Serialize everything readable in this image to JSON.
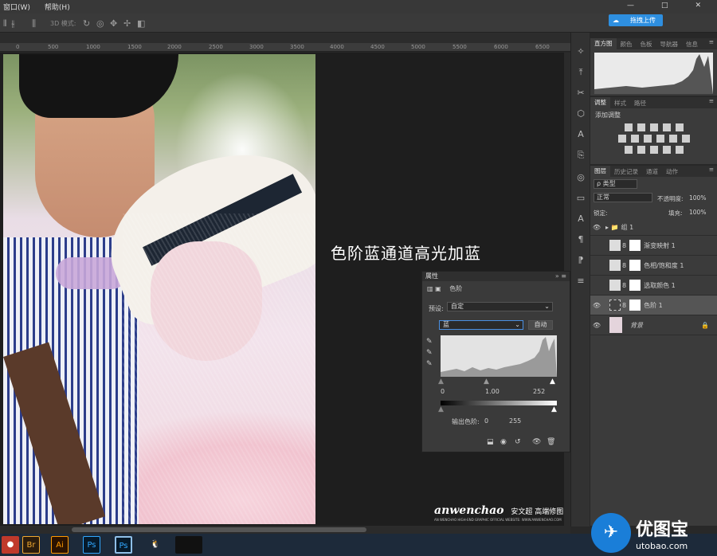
{
  "menubar": {
    "items": [
      "窗口(W)",
      "帮助(H)"
    ]
  },
  "window_controls": [
    "—",
    "□",
    "✕"
  ],
  "options_bar": {
    "mode_label": "3D 模式:"
  },
  "sync_button": {
    "label": "拖拽上传"
  },
  "ruler": {
    "ticks": [
      "0",
      "500",
      "1000",
      "1500",
      "2000",
      "2500",
      "3000",
      "3500",
      "4000",
      "4500",
      "5000",
      "5500",
      "6000",
      "6500"
    ]
  },
  "canvas": {
    "caption": "色阶蓝通道高光加蓝"
  },
  "watermark": {
    "brand": "anwenchao",
    "cn": "安文超 高端修图",
    "small": "AN WENCHAO HIGH-END GRAPHIC OFFICIAL WEBSITE: WWW.ANWENCHAO.COM"
  },
  "histogram_panel": {
    "tabs": [
      "直方图",
      "颜色",
      "色板",
      "导航器",
      "信息"
    ]
  },
  "adjustments_panel": {
    "tabs": [
      "调整",
      "样式",
      "路径"
    ],
    "title": "添加调整"
  },
  "layers_panel": {
    "tabs": [
      "图层",
      "历史记录",
      "通道",
      "动作"
    ],
    "filter_label": "ρ 类型",
    "blend_mode": "正常",
    "opacity_label": "不透明度:",
    "opacity_value": "100%",
    "lock_label": "锁定:",
    "fill_label": "填充:",
    "fill_value": "100%",
    "layers": [
      {
        "name": "组 1",
        "visible": true
      },
      {
        "name": "渐变映射 1",
        "visible": false
      },
      {
        "name": "色相/饱和度 1",
        "visible": false
      },
      {
        "name": "选取颜色 1",
        "visible": false
      },
      {
        "name": "色阶 1",
        "visible": true
      },
      {
        "name": "背景",
        "visible": true
      }
    ]
  },
  "properties_panel": {
    "title": "属性",
    "subtitle": "色阶",
    "preset_label": "预设:",
    "preset_value": "自定",
    "channel_value": "蓝",
    "auto_label": "自动",
    "input_black": "0",
    "input_gamma": "1.00",
    "input_white": "252",
    "output_label": "输出色阶:",
    "output_black": "0",
    "output_white": "255"
  },
  "taskbar": {
    "items": [
      "Br",
      "Ai",
      "Ps",
      "Ps"
    ]
  },
  "corner_logo": {
    "cn": "优图宝",
    "en": "utobao.com"
  }
}
